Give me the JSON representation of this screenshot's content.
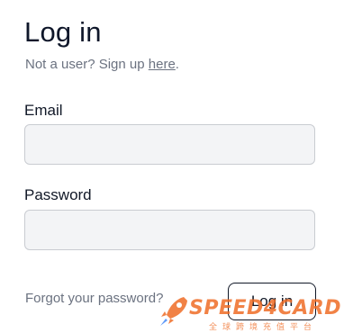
{
  "form": {
    "title": "Log in",
    "signup_prefix": "Not a user? Sign up ",
    "signup_link": "here",
    "signup_suffix": ".",
    "email_label": "Email",
    "email_value": "",
    "password_label": "Password",
    "password_value": "",
    "forgot_label": "Forgot your password?",
    "submit_label": "Log in"
  },
  "watermark": {
    "brand": "SPEED4CARD",
    "tagline": "全球跨境充值平台",
    "color": "#ef6c26"
  }
}
